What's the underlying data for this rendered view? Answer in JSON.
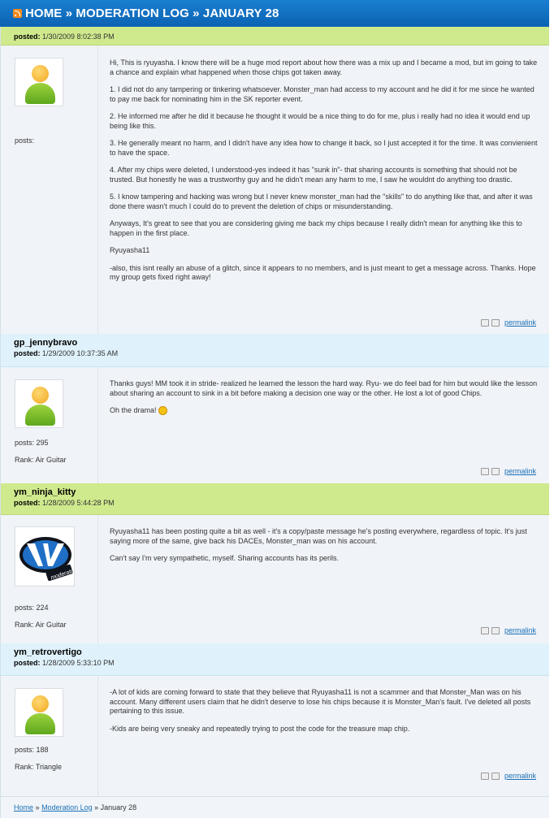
{
  "header": {
    "home": "HOME",
    "sep1": "»",
    "section": "MODERATION LOG",
    "sep2": "»",
    "page": "JANUARY 28"
  },
  "posts": [
    {
      "author": "",
      "posted_label": "posted:",
      "posted": "1/30/2009 8:02:38 PM",
      "posts_label": "posts:",
      "posts_count": "",
      "rank": "",
      "avatar": "default-avatar",
      "paragraphs": [
        "Hi, This is ryuyasha. I know there will be a huge mod report about how there was a mix up and I became a mod, but im going to take a chance and explain what happened when those chips got taken away.",
        "1. I did not do any tampering or tinkering whatsoever. Monster_man had access to my account and he did it for me since he wanted to pay me back for nominating him in the SK reporter event.",
        "2. He informed me after he did it because he thought it would be a nice thing to do for me, plus i really had no idea it would end up being like this.",
        "3. He generally meant no harm, and I didn't have any idea how to change it back, so I just accepted it for the time. It was convienient to have the space.",
        "4. After my chips were deleted, I understood-yes indeed it has \"sunk in\"- that sharing accounts is something that should not be trusted. But honestly he was a trustworthy guy and he didn't mean any harm to me, I saw he wouldnt do anything too drastic.",
        "5. I know tampering and hacking was wrong but I never knew monster_man had the \"skills\" to do anything like that, and after it was done there wasn't much I could do to prevent the deletion of chips or misunderstanding.",
        "Anyways, It's great to see that you are considering giving me back my chips because I really didn't mean for anything like this to happen in the first place.",
        "Ryuyasha11",
        "-also, this isnt really an abuse of a glitch, since it appears to no members, and is just meant to get a message across. Thanks. Hope my group gets fixed right away!"
      ],
      "permalink": "permalink"
    },
    {
      "author": "gp_jennybravo",
      "posted_label": "posted:",
      "posted": "1/29/2009 10:37:35 AM",
      "posts_label": "posts:",
      "posts_count": "295",
      "rank_label": "Rank:",
      "rank": "Air Guitar",
      "avatar": "default-avatar",
      "paragraphs": [
        "Thanks guys! MM took it in stride- realized he learned the lesson the hard way. Ryu- we do feel bad for him but would like the lesson about sharing an account to sink in a bit before making a decision one way or the other. He lost a lot of good Chips.",
        "Oh the drama!"
      ],
      "permalink": "permalink"
    },
    {
      "author": "ym_ninja_kitty",
      "posted_label": "posted:",
      "posted": "1/28/2009 5:44:28 PM",
      "posts_label": "posts:",
      "posts_count": "224",
      "rank_label": "Rank:",
      "rank": "Air Guitar",
      "avatar": "moderator-logo",
      "paragraphs": [
        "Ryuyasha11 has been posting quite a bit as well - it's a copy/paste message he's posting everywhere, regardless of topic. It's just saying more of the same, give back his DACEs, Monster_man was on his account.",
        "Can't say I'm very sympathetic, myself. Sharing accounts has its perils."
      ],
      "permalink": "permalink"
    },
    {
      "author": "ym_retrovertigo",
      "posted_label": "posted:",
      "posted": "1/28/2009 5:33:10 PM",
      "posts_label": "posts:",
      "posts_count": "188",
      "rank_label": "Rank:",
      "rank": "Triangle",
      "avatar": "default-avatar",
      "paragraphs": [
        "-A lot of kids are coming forward to state that they believe that Ryuyasha11 is not a scammer and that Monster_Man was on his account. Many different users claim that he didn't deserve to lose his chips because it is Monster_Man's fault. I've deleted all posts pertaining to this issue.",
        "-Kids are being very sneaky and repeatedly trying to post the code for the treasure map chip."
      ],
      "permalink": "permalink"
    }
  ],
  "breadcrumb": {
    "home": "Home",
    "sep1": "»",
    "section": "Moderation Log",
    "sep2": "»",
    "page": "January 28"
  },
  "colors": {
    "header_blue": "#0b62b2",
    "green_head": "#cfe98d",
    "blue_head": "#dff2fb",
    "link": "#1a6fb5"
  }
}
